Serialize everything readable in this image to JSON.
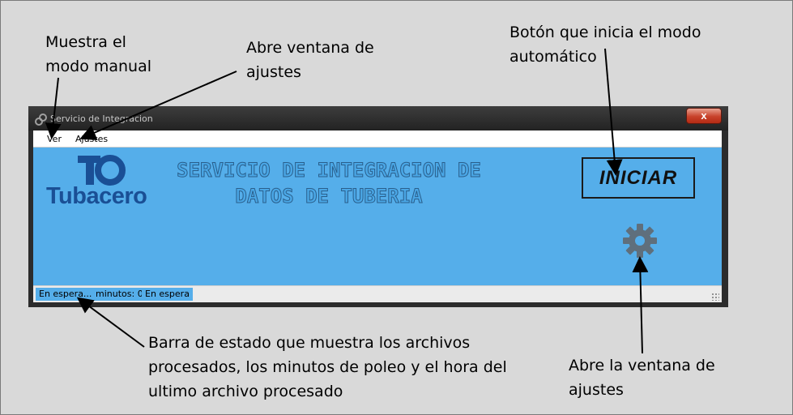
{
  "annotations": {
    "manual_mode": "Muestra el\nmodo manual",
    "settings_menu": "Abre ventana de\najustes",
    "start_button": "Botón que inicia el modo\nautomático",
    "status_bar": "Barra de estado que muestra los archivos\nprocesados, los minutos de poleo y el hora del\nultimo archivo procesado",
    "settings_icon": "Abre la ventana de\najustes"
  },
  "window": {
    "title": "Servicio de Integracion",
    "close_label": "x"
  },
  "menu": {
    "ver": "Ver",
    "ajustes": "Ajustes"
  },
  "content": {
    "logo_text": "Tubacero",
    "headline_line1": "SERVICIO DE INTEGRACION DE",
    "headline_line2": "DATOS DE TUBERIA",
    "start_label": "INICIAR",
    "settings_icon": "gear-icon"
  },
  "status": {
    "state": "En espera...",
    "minutes": "minutos: 0",
    "last": "En espera"
  },
  "colors": {
    "content_bg": "#55aeea",
    "logo": "#1a4f95",
    "titlebar": "#2c2c2c"
  }
}
